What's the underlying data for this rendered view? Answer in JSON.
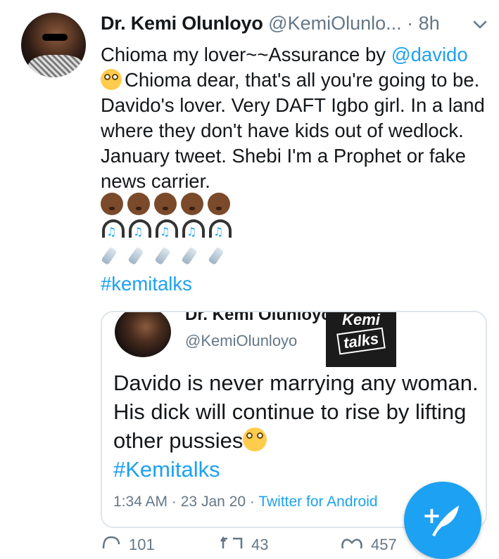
{
  "tweet": {
    "display_name": "Dr. Kemi Olunloyo",
    "handle": "@KemiOlunlo...",
    "separator": "·",
    "time": "8h",
    "text_part1": "Chioma my lover~~Assurance by ",
    "mention": "@davido",
    "text_part2": "Chioma dear, that's all you're going to be. Davido's lover. Very DAFT Igbo girl. In a land where they don't have kids out of wedlock. January tweet. Shebi I'm a Prophet or fake news carrier.",
    "hashtag": "#kemitalks",
    "emoji_rows": [
      "baby-emoji",
      "headphones-emoji",
      "baby-bottle-emoji"
    ],
    "emoji_count_per_row": 5
  },
  "quoted": {
    "display_name": "Dr. Kemi Olunloyo",
    "handle": "@KemiOlunloyo",
    "logo_line1": "Kemi",
    "logo_line2": "talks",
    "text": "Davido is never marrying any woman. His dick will continue to rise by lifting other pussies",
    "hashtag": "#Kemitalks",
    "meta_time": "1:34 AM",
    "meta_sep": "·",
    "meta_date": "23 Jan 20",
    "meta_source": "Twitter for Android"
  },
  "actions": {
    "reply_count": "101",
    "retweet_count": "43",
    "like_count": "457"
  },
  "colors": {
    "accent": "#1da1f2",
    "muted": "#657786",
    "text": "#14171a"
  }
}
